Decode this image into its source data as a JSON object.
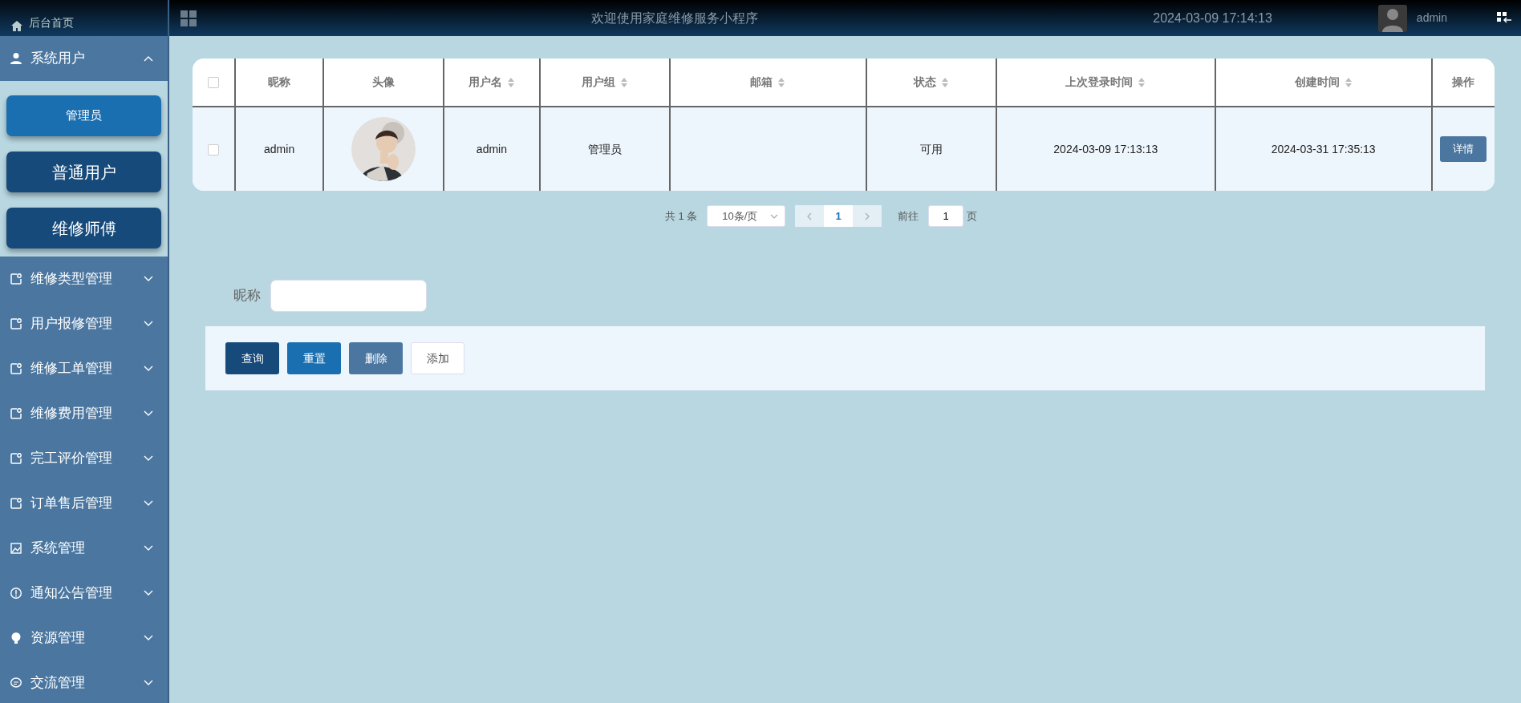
{
  "sidebar": {
    "home": "后台首页",
    "menus": [
      {
        "label": "系统用户",
        "expanded": true,
        "children": [
          {
            "label": "管理员",
            "selected": true
          },
          {
            "label": "普通用户",
            "selected": false
          },
          {
            "label": "维修师傅",
            "selected": false
          }
        ]
      },
      {
        "label": "维修类型管理",
        "expanded": false
      },
      {
        "label": "用户报修管理",
        "expanded": false
      },
      {
        "label": "维修工单管理",
        "expanded": false
      },
      {
        "label": "维修费用管理",
        "expanded": false
      },
      {
        "label": "完工评价管理",
        "expanded": false
      },
      {
        "label": "订单售后管理",
        "expanded": false
      },
      {
        "label": "系统管理",
        "expanded": false
      },
      {
        "label": "通知公告管理",
        "expanded": false
      },
      {
        "label": "资源管理",
        "expanded": false
      },
      {
        "label": "交流管理",
        "expanded": false
      }
    ]
  },
  "header": {
    "title": "欢迎使用家庭维修服务小程序",
    "datetime": "2024-03-09 17:14:13",
    "user": "admin"
  },
  "table": {
    "select_all": {
      "checked": false
    },
    "columns": [
      {
        "label": "昵称",
        "sortable": false
      },
      {
        "label": "头像",
        "sortable": false
      },
      {
        "label": "用户名",
        "sortable": true
      },
      {
        "label": "用户组",
        "sortable": true
      },
      {
        "label": "邮箱",
        "sortable": true
      },
      {
        "label": "状态",
        "sortable": true
      },
      {
        "label": "上次登录时间",
        "sortable": true
      },
      {
        "label": "创建时间",
        "sortable": true
      },
      {
        "label": "操作",
        "sortable": false
      }
    ],
    "rows": [
      {
        "checked": false,
        "nickname": "admin",
        "username": "admin",
        "group": "管理员",
        "status": "可用",
        "last_login": "2024-03-09 17:13:13",
        "created": "2024-03-31 17:35:13",
        "action": "详情"
      }
    ]
  },
  "pagination": {
    "total": "共 1 条",
    "page_size": "10条/页",
    "pages": [
      {
        "label": "1",
        "selected": true
      }
    ],
    "goto_label": "前往",
    "goto_value": "1",
    "goto_suffix": "页"
  },
  "search": {
    "label": "昵称"
  },
  "buttons": [
    {
      "label": "查询",
      "kind": "query"
    },
    {
      "label": "重置",
      "kind": "reset"
    },
    {
      "label": "删除",
      "kind": "delete"
    },
    {
      "label": "添加",
      "kind": "add"
    }
  ]
}
